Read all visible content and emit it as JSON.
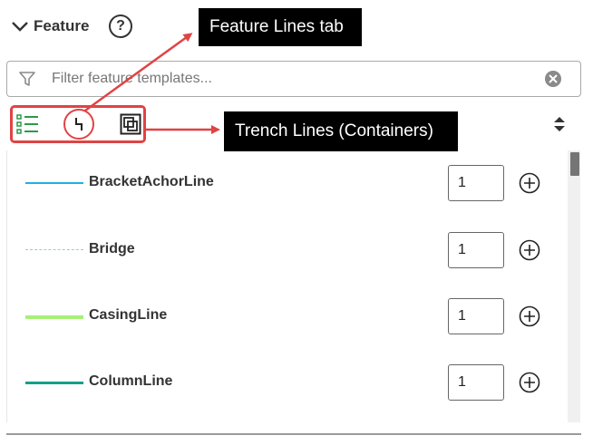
{
  "header": {
    "title": "Feature",
    "help_glyph": "?"
  },
  "filter": {
    "placeholder": "Filter feature templates..."
  },
  "toolbar": {
    "icons": [
      "list-icon",
      "feature-lines-icon",
      "container-icon"
    ],
    "highlight_color": "#e04343"
  },
  "features": [
    {
      "label": "BracketAchorLine",
      "count": "1",
      "line_color": "#1ab4e6",
      "line_style": "solid"
    },
    {
      "label": "Bridge",
      "count": "1",
      "line_color": "#7fd4e8",
      "line_style": "dash-dot"
    },
    {
      "label": "CasingLine",
      "count": "1",
      "line_color": "#a8f07a",
      "line_style": "solid"
    },
    {
      "label": "ColumnLine",
      "count": "1",
      "line_color": "#13a089",
      "line_style": "solid"
    }
  ],
  "annotations": {
    "feature_lines_tab": "Feature Lines tab",
    "trench_lines": "Trench Lines (Containers)"
  }
}
